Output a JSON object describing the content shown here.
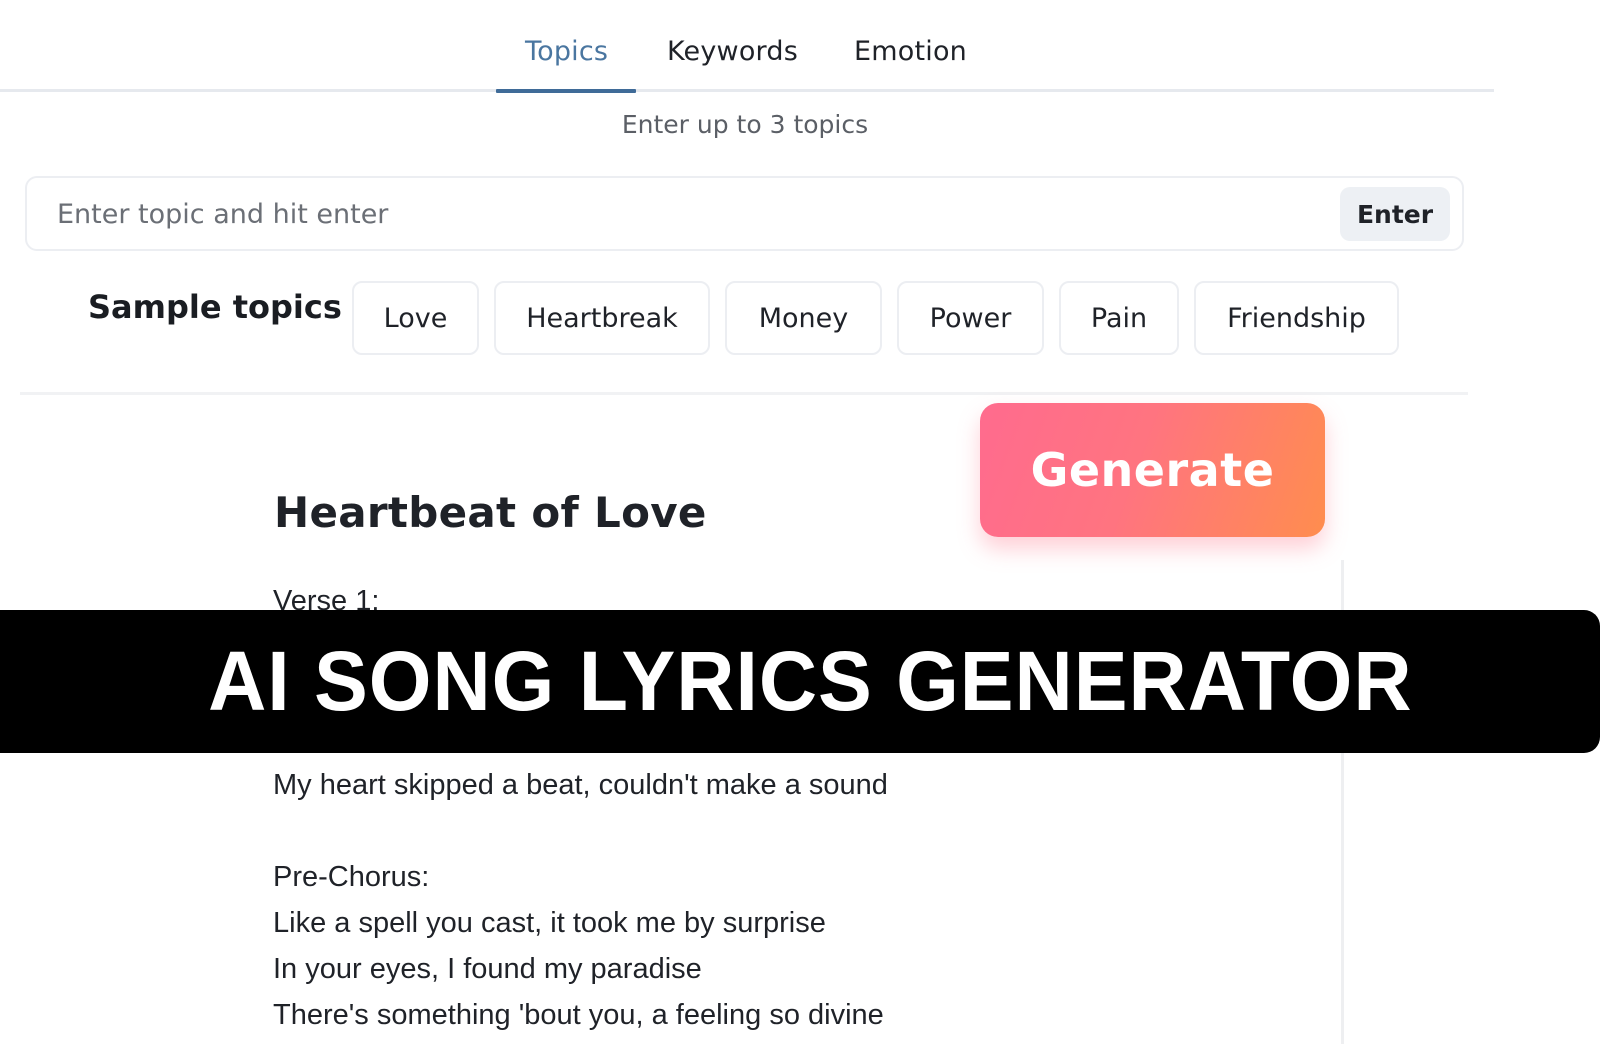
{
  "tabs": [
    {
      "label": "Topics",
      "active": true
    },
    {
      "label": "Keywords",
      "active": false
    },
    {
      "label": "Emotion",
      "active": false
    }
  ],
  "hint": "Enter up to 3 topics",
  "input": {
    "placeholder": "Enter topic and hit enter",
    "value": "",
    "enter_label": "Enter"
  },
  "sample_topics": {
    "label": "Sample topics",
    "items": [
      "Love",
      "Heartbreak",
      "Money",
      "Power",
      "Pain",
      "Friendship"
    ]
  },
  "generate": {
    "label": "Generate",
    "gradient_start": "#ff6b8e",
    "gradient_end": "#ff8d4e"
  },
  "song": {
    "title": "Heartbeat of Love",
    "lines": [
      "Verse 1:",
      "",
      "",
      "",
      "My heart skipped a beat, couldn't make a sound",
      "",
      "Pre-Chorus:",
      "Like a spell you cast, it took me by surprise",
      "In your eyes, I found my paradise",
      "There's something 'bout you, a feeling so divine"
    ]
  },
  "banner": {
    "text": "AI SONG LYRICS GENERATOR"
  },
  "colors": {
    "active_tab": "#4a76a0",
    "tab_underline": "#3f6b98",
    "banner_bg": "#000000"
  }
}
